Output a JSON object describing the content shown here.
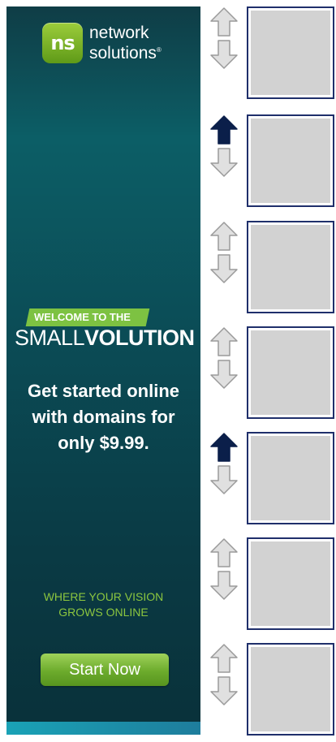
{
  "ad": {
    "brand_line1": "network",
    "brand_line2": "solutions",
    "brand_mark": "®",
    "logo_letters": "ns",
    "welcome": "WELCOME TO THE",
    "title_light": "SMALL",
    "title_bold": "VOLUTION",
    "offer_line1": "Get started online",
    "offer_line2": "with domains for",
    "offer_line3": "only $9.99.",
    "tagline_line1": "WHERE YOUR VISION",
    "tagline_line2": "GROWS ONLINE",
    "cta": "Start Now",
    "colors": {
      "accent_green": "#7dc242",
      "background_teal": "#0b4c56"
    }
  },
  "list": {
    "items": [
      {
        "upvoted": false,
        "thumbnail": "thumbnail-image"
      },
      {
        "upvoted": true,
        "thumbnail": "thumbnail-image"
      },
      {
        "upvoted": false,
        "thumbnail": "thumbnail-image"
      },
      {
        "upvoted": false,
        "thumbnail": "thumbnail-image"
      },
      {
        "upvoted": true,
        "thumbnail": "thumbnail-image"
      },
      {
        "upvoted": false,
        "thumbnail": "thumbnail-image"
      },
      {
        "upvoted": false,
        "thumbnail": "thumbnail-image"
      }
    ],
    "icons": {
      "up": "up-arrow-icon",
      "down": "down-arrow-icon"
    },
    "colors": {
      "arrow_inactive": "#e0e0e0",
      "arrow_outline": "#9a9a9a",
      "arrow_active": "#0b1f4a",
      "thumb_border": "#1f2f6b"
    }
  }
}
